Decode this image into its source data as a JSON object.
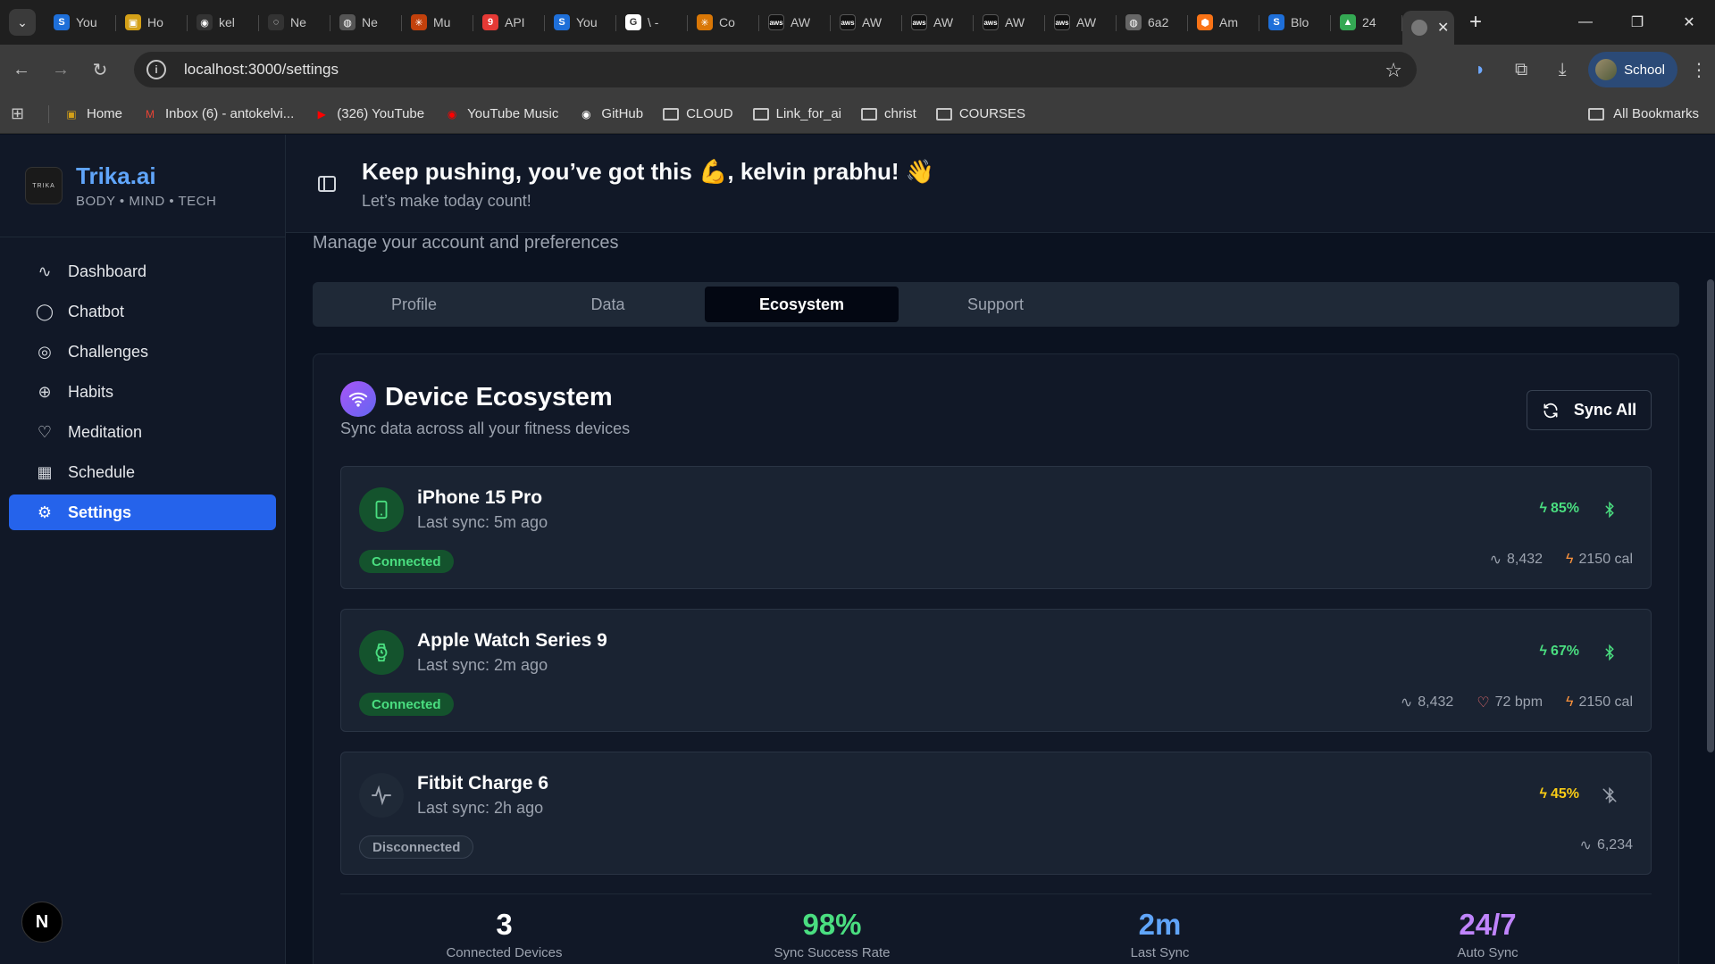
{
  "browser": {
    "tabs": [
      {
        "title": "You",
        "icon": "S",
        "color": "#1e6fd9"
      },
      {
        "title": "Ho",
        "icon": "▣",
        "color": "#d4a017"
      },
      {
        "title": "kel",
        "icon": "◉",
        "color": "#333333"
      },
      {
        "title": "Ne",
        "icon": "◌",
        "color": "#333333"
      },
      {
        "title": "Ne",
        "icon": "◍",
        "color": "#555555"
      },
      {
        "title": "Mu",
        "icon": "✳",
        "color": "#c2410c"
      },
      {
        "title": "API",
        "icon": "9",
        "color": "#e53935"
      },
      {
        "title": "You",
        "icon": "S",
        "color": "#1e6fd9"
      },
      {
        "title": "\\ -",
        "icon": "G",
        "color": "#ffffff"
      },
      {
        "title": "Co",
        "icon": "✳",
        "color": "#d97706"
      },
      {
        "title": "AW",
        "icon": "aws",
        "color": "#111111"
      },
      {
        "title": "AW",
        "icon": "aws",
        "color": "#111111"
      },
      {
        "title": "AW",
        "icon": "aws",
        "color": "#111111"
      },
      {
        "title": "AW",
        "icon": "aws",
        "color": "#111111"
      },
      {
        "title": "AW",
        "icon": "aws",
        "color": "#111111"
      },
      {
        "title": "6a2",
        "icon": "◍",
        "color": "#666666"
      },
      {
        "title": "Am",
        "icon": "⬢",
        "color": "#f97316"
      },
      {
        "title": "Blo",
        "icon": "S",
        "color": "#1e6fd9"
      },
      {
        "title": "24",
        "icon": "▲",
        "color": "#34a853"
      }
    ],
    "url": "localhost:3000/settings",
    "profile_label": "School",
    "bookmarks": [
      {
        "label": "Home",
        "icon": "▣",
        "color": "#d4a017"
      },
      {
        "label": "Inbox (6) - antokelvi...",
        "icon": "M",
        "color": "#ea4335"
      },
      {
        "label": "(326) YouTube",
        "icon": "▶",
        "color": "#ff0000"
      },
      {
        "label": "YouTube Music",
        "icon": "◉",
        "color": "#ff0000"
      },
      {
        "label": "GitHub",
        "icon": "◉",
        "color": "#ffffff"
      },
      {
        "label": "CLOUD",
        "icon": "folder",
        "color": ""
      },
      {
        "label": "Link_for_ai",
        "icon": "folder",
        "color": ""
      },
      {
        "label": "christ",
        "icon": "folder",
        "color": ""
      },
      {
        "label": "COURSES",
        "icon": "folder",
        "color": ""
      }
    ],
    "all_bookmarks": "All Bookmarks"
  },
  "app": {
    "brand": {
      "name": "Trika.ai",
      "tagline": "BODY • MIND • TECH",
      "logo_text": "TRIKA"
    },
    "nav": [
      {
        "label": "Dashboard",
        "icon": "activity-icon",
        "glyph": "∿"
      },
      {
        "label": "Chatbot",
        "icon": "chat-bubble-icon",
        "glyph": "◯"
      },
      {
        "label": "Challenges",
        "icon": "target-icon",
        "glyph": "◎"
      },
      {
        "label": "Habits",
        "icon": "globe-icon",
        "glyph": "⊕"
      },
      {
        "label": "Meditation",
        "icon": "heart-icon",
        "glyph": "♡"
      },
      {
        "label": "Schedule",
        "icon": "calendar-icon",
        "glyph": "▦"
      },
      {
        "label": "Settings",
        "icon": "gear-icon",
        "glyph": "⚙"
      }
    ],
    "active_nav": 6,
    "n_badge": "N",
    "header": {
      "greeting": "Keep pushing, you’ve got this 💪, kelvin prabhu! 👋",
      "subtitle": "Let’s make today count!"
    },
    "page_subtitle": "Manage your account and preferences",
    "settings_tabs": [
      "Profile",
      "Data",
      "Ecosystem",
      "Support"
    ],
    "active_tab": 2,
    "ecosystem": {
      "title": "Device Ecosystem",
      "subtitle": "Sync data across all your fitness devices",
      "sync_all": "Sync All",
      "devices": [
        {
          "name": "iPhone 15 Pro",
          "last_sync": "Last sync: 5m ago",
          "status": "Connected",
          "connected": true,
          "battery": "85%",
          "battery_color": "#4ade80",
          "icon": "phone-icon",
          "metrics": [
            {
              "icon": "activity-icon",
              "glyph": "∿",
              "value": "8,432",
              "color": "#9ca3af"
            },
            {
              "icon": "bolt-icon",
              "glyph": "ϟ",
              "value": "2150 cal",
              "color": "#fb923c"
            }
          ]
        },
        {
          "name": "Apple Watch Series 9",
          "last_sync": "Last sync: 2m ago",
          "status": "Connected",
          "connected": true,
          "battery": "67%",
          "battery_color": "#4ade80",
          "icon": "watch-icon",
          "metrics": [
            {
              "icon": "activity-icon",
              "glyph": "∿",
              "value": "8,432",
              "color": "#9ca3af"
            },
            {
              "icon": "heart-icon",
              "glyph": "♡",
              "value": "72 bpm",
              "color": "#f87171"
            },
            {
              "icon": "bolt-icon",
              "glyph": "ϟ",
              "value": "2150 cal",
              "color": "#fb923c"
            }
          ]
        },
        {
          "name": "Fitbit Charge 6",
          "last_sync": "Last sync: 2h ago",
          "status": "Disconnected",
          "connected": false,
          "battery": "45%",
          "battery_color": "#facc15",
          "icon": "activity-icon",
          "metrics": [
            {
              "icon": "activity-icon",
              "glyph": "∿",
              "value": "6,234",
              "color": "#9ca3af"
            }
          ]
        }
      ],
      "stats": [
        {
          "value": "3",
          "label": "Connected Devices",
          "color": "#ffffff"
        },
        {
          "value": "98%",
          "label": "Sync Success Rate",
          "color": "#4ade80"
        },
        {
          "value": "2m",
          "label": "Last Sync",
          "color": "#60a5fa"
        },
        {
          "value": "24/7",
          "label": "Auto Sync",
          "color": "#c084fc"
        }
      ]
    }
  }
}
